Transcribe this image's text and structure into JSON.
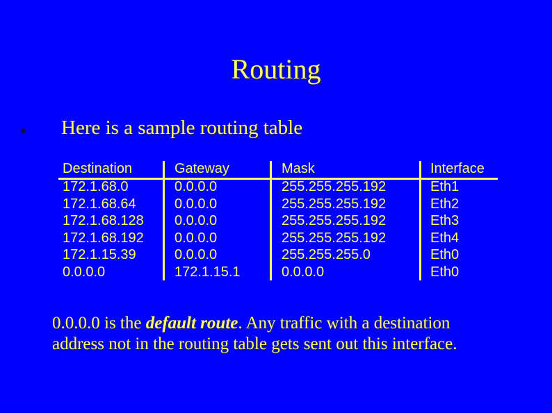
{
  "slide": {
    "background_color": "#0000FF",
    "text_color": "#FFFF66",
    "title": "Routing",
    "bullet": "Here is a sample routing table",
    "table": {
      "headers": [
        "Destination",
        "Gateway",
        "Mask",
        "Interface"
      ],
      "rows": [
        [
          "172.1.68.0",
          "0.0.0.0",
          "255.255.255.192",
          "Eth1"
        ],
        [
          "172.1.68.64",
          "0.0.0.0",
          "255.255.255.192",
          "Eth2"
        ],
        [
          "172.1.68.128",
          "0.0.0.0",
          "255.255.255.192",
          "Eth3"
        ],
        [
          "172.1.68.192",
          "0.0.0.0",
          "255.255.255.192",
          "Eth4"
        ],
        [
          "172.1.15.39",
          "0.0.0.0",
          "255.255.255.0",
          "Eth0"
        ],
        [
          "0.0.0.0",
          "172.1.15.1",
          "0.0.0.0",
          "Eth0"
        ]
      ]
    },
    "footer": {
      "prefix": "0.0.0.0 is the ",
      "emphasis": "default route",
      "suffix_line1": ".  Any traffic with a destination",
      "line2": "address not in the routing table gets sent out this interface."
    }
  }
}
